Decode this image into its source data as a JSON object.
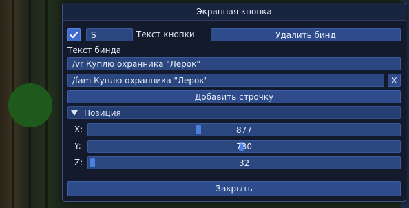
{
  "window": {
    "title": "Экранная кнопка"
  },
  "button_row": {
    "checkbox_checked": true,
    "button_text_value": "S",
    "button_text_label": "Текст кнопки",
    "delete_label": "Удалить бинд"
  },
  "bind_text": {
    "label": "Текст бинда",
    "lines": [
      "/vr Куплю охранника \"Лерок\"",
      "/fam Куплю охранника \"Лерок\""
    ],
    "remove_line_label": "X",
    "add_line_label": "Добавить строчку"
  },
  "position": {
    "header": "Позиция",
    "axes": [
      {
        "label": "X:",
        "value": "877",
        "slider_fraction": 0.35
      },
      {
        "label": "Y:",
        "value": "730",
        "slider_fraction": 0.49
      },
      {
        "label": "Z:",
        "value": "32",
        "slider_fraction": 0.003
      }
    ]
  },
  "footer": {
    "close_label": "Закрыть"
  },
  "colors": {
    "accent": "#3f6bcc",
    "panel": "#121a2c",
    "control": "#2b477f"
  }
}
